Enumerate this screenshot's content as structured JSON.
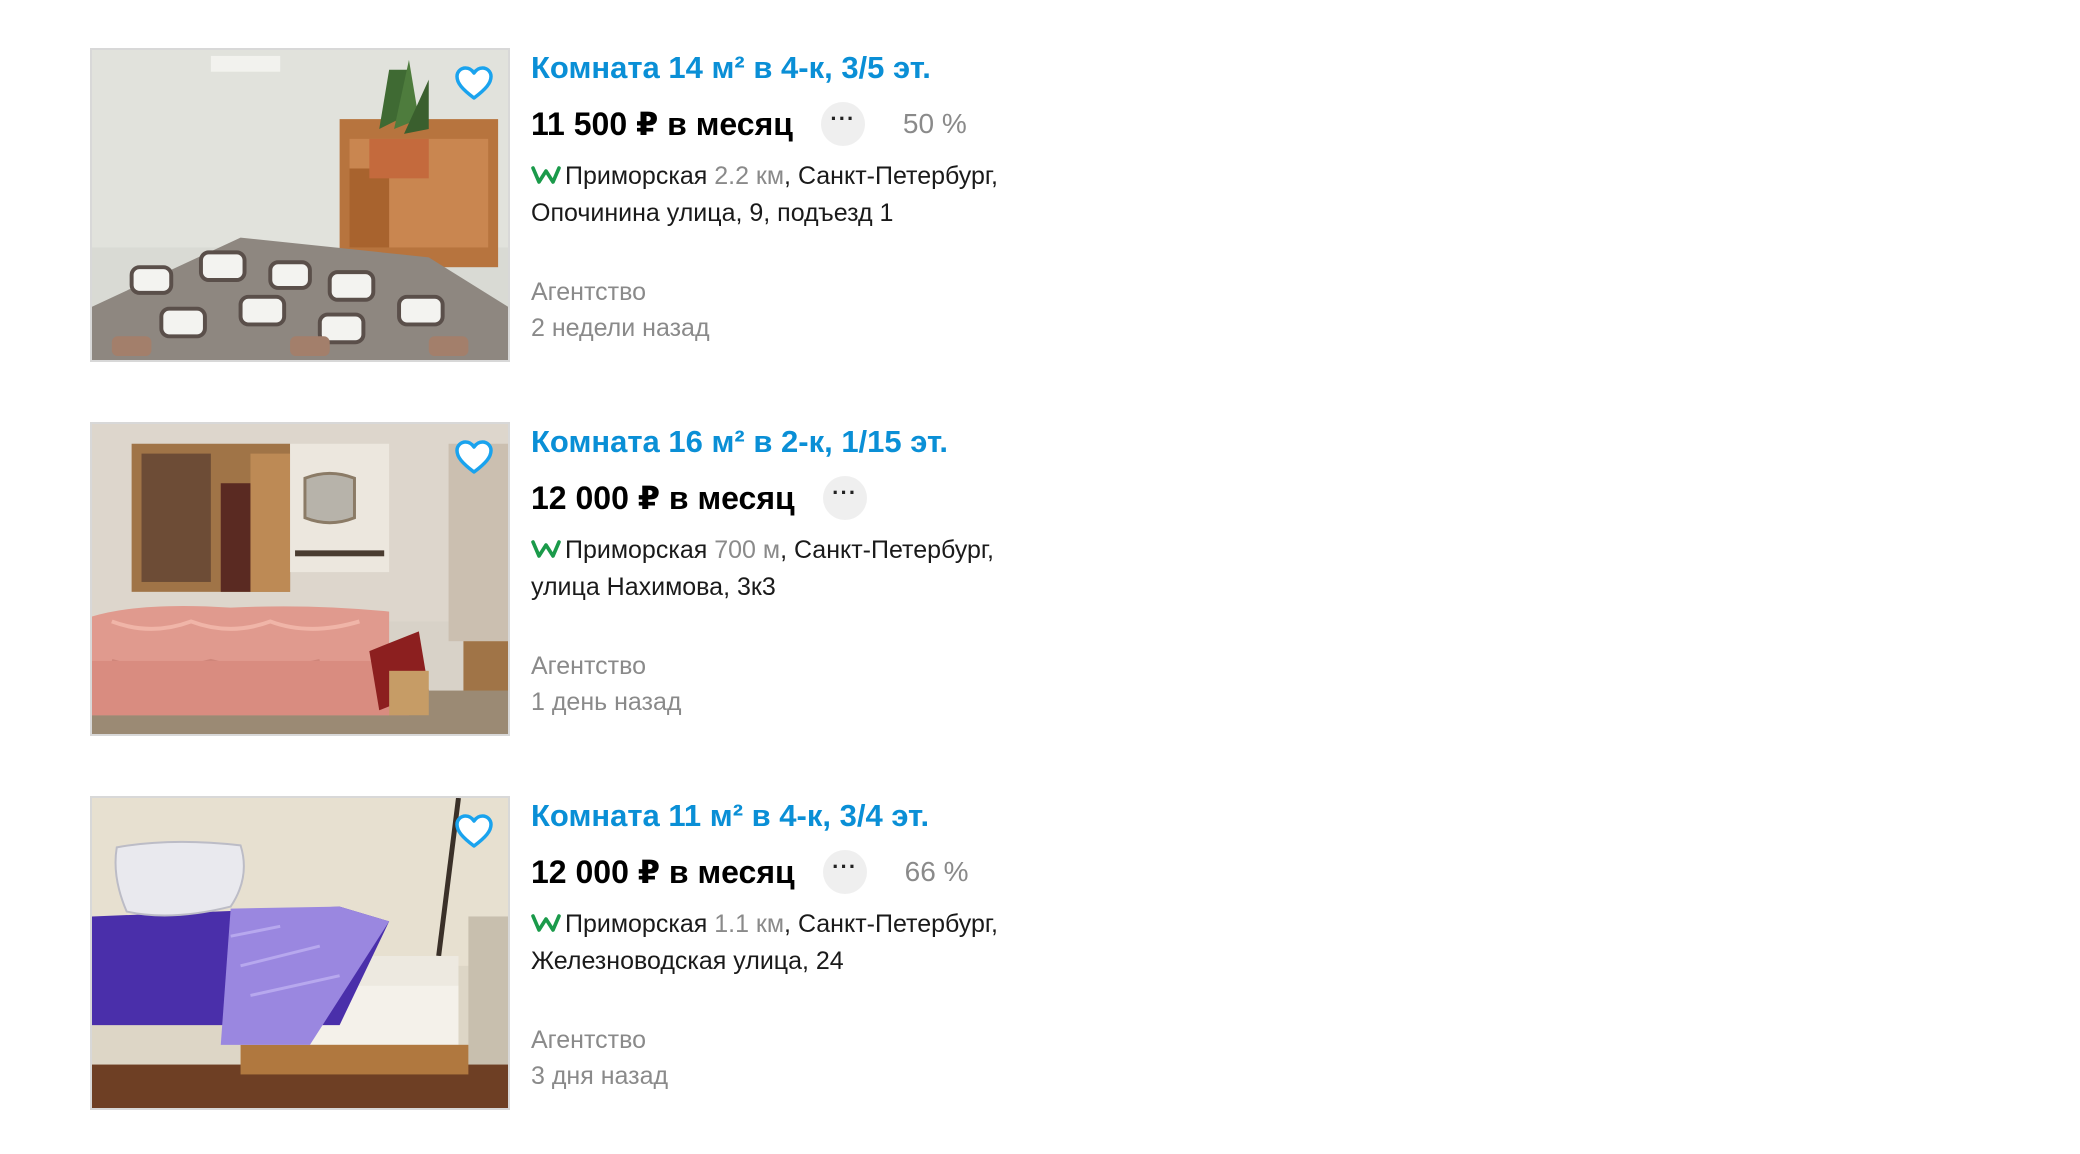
{
  "colors": {
    "title": "#0a8fd6",
    "metro": "#1a9a4a",
    "muted": "#8a8a8a",
    "heart": "#ffffff",
    "heart_outline": "#1aa3ee"
  },
  "listings": [
    {
      "title": "Комната 14 м² в 4-к, 3/5 эт.",
      "price": "11 500 ₽ в месяц",
      "more_label": "···",
      "percent": "50 %",
      "metro_icon": "metro-icon",
      "station": "Приморская",
      "distance": "2.2 км",
      "address_line1": ", Санкт-Петербург,",
      "address_line2": "Опочинина улица, 9, подъезд 1",
      "seller": "Агентство",
      "posted": "2 недели назад",
      "favorite_icon": "heart-icon"
    },
    {
      "title": "Комната 16 м² в 2-к, 1/15 эт.",
      "price": "12 000 ₽ в месяц",
      "more_label": "···",
      "percent": "",
      "metro_icon": "metro-icon",
      "station": "Приморская",
      "distance": "700 м",
      "address_line1": ", Санкт-Петербург,",
      "address_line2": "улица Нахимова, 3к3",
      "seller": "Агентство",
      "posted": "1 день назад",
      "favorite_icon": "heart-icon"
    },
    {
      "title": "Комната 11 м² в 4-к, 3/4 эт.",
      "price": "12 000 ₽ в месяц",
      "more_label": "···",
      "percent": "66 %",
      "metro_icon": "metro-icon",
      "station": "Приморская",
      "distance": "1.1 км",
      "address_line1": ", Санкт-Петербург,",
      "address_line2": "Железноводская улица, 24",
      "seller": "Агентство",
      "posted": "3 дня назад",
      "favorite_icon": "heart-icon"
    }
  ]
}
